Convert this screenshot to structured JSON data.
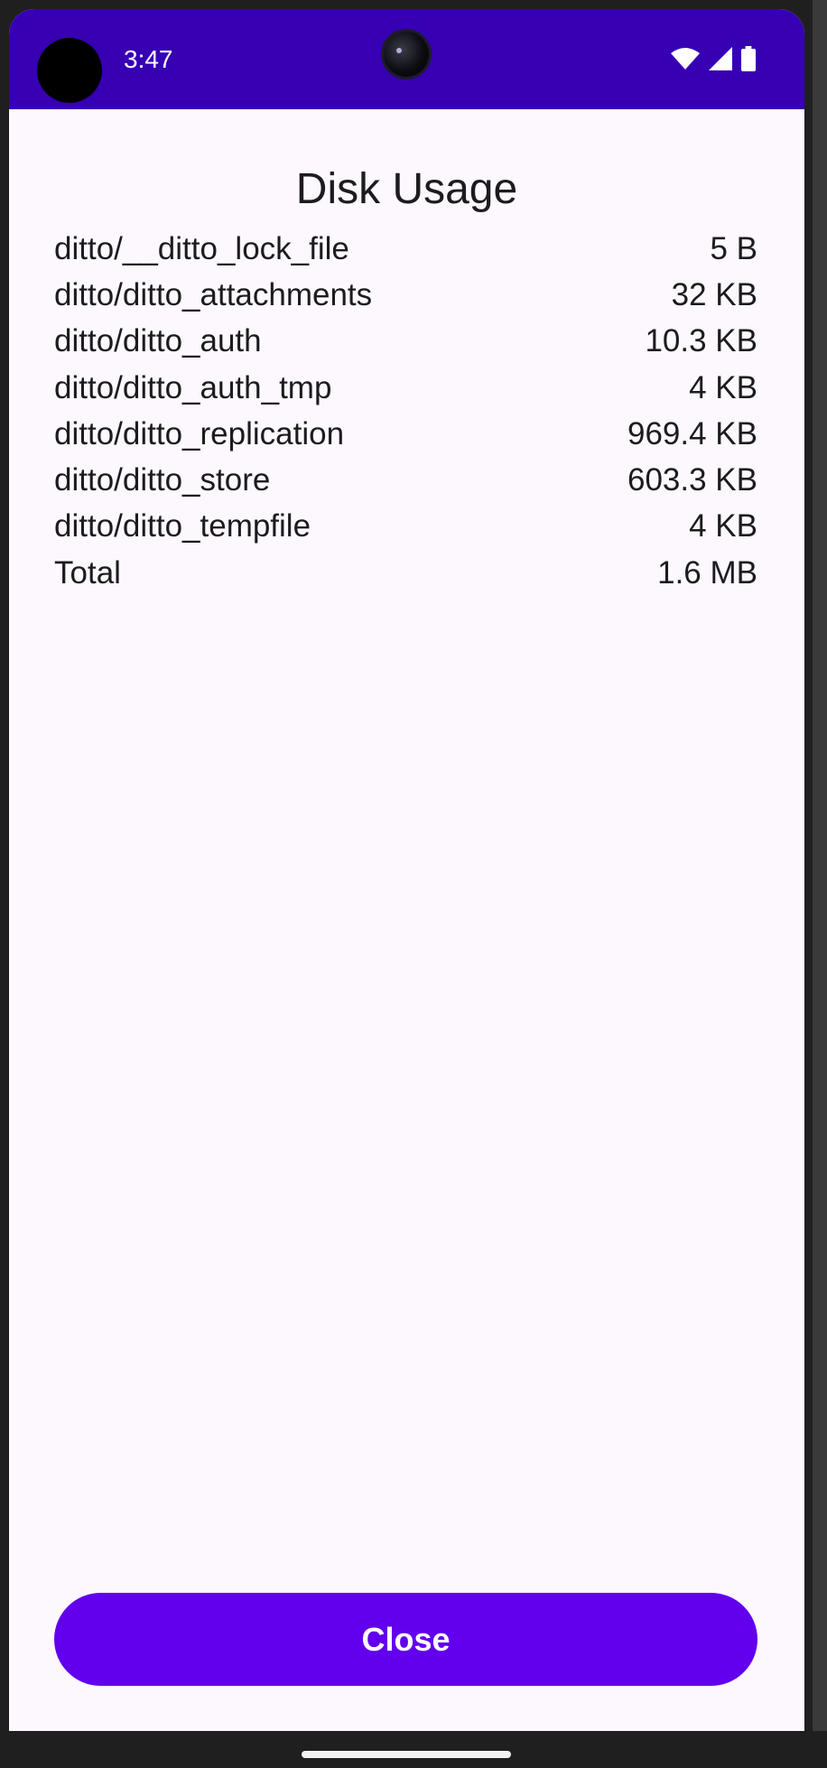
{
  "status_bar": {
    "time": "3:47",
    "icons": [
      "wifi-icon",
      "cellular-signal-icon",
      "battery-icon"
    ],
    "color": "#3700b3"
  },
  "dialog": {
    "title": "Disk Usage",
    "entries": [
      {
        "name": "ditto/__ditto_lock_file",
        "size": "5 B"
      },
      {
        "name": "ditto/ditto_attachments",
        "size": "32 KB"
      },
      {
        "name": "ditto/ditto_auth",
        "size": "10.3 KB"
      },
      {
        "name": "ditto/ditto_auth_tmp",
        "size": "4 KB"
      },
      {
        "name": "ditto/ditto_replication",
        "size": "969.4 KB"
      },
      {
        "name": "ditto/ditto_store",
        "size": "603.3 KB"
      },
      {
        "name": "ditto/ditto_tempfile",
        "size": "4 KB"
      }
    ],
    "total": {
      "label": "Total",
      "size": "1.6 MB"
    },
    "close_label": "Close",
    "accent_color": "#6200ee"
  }
}
